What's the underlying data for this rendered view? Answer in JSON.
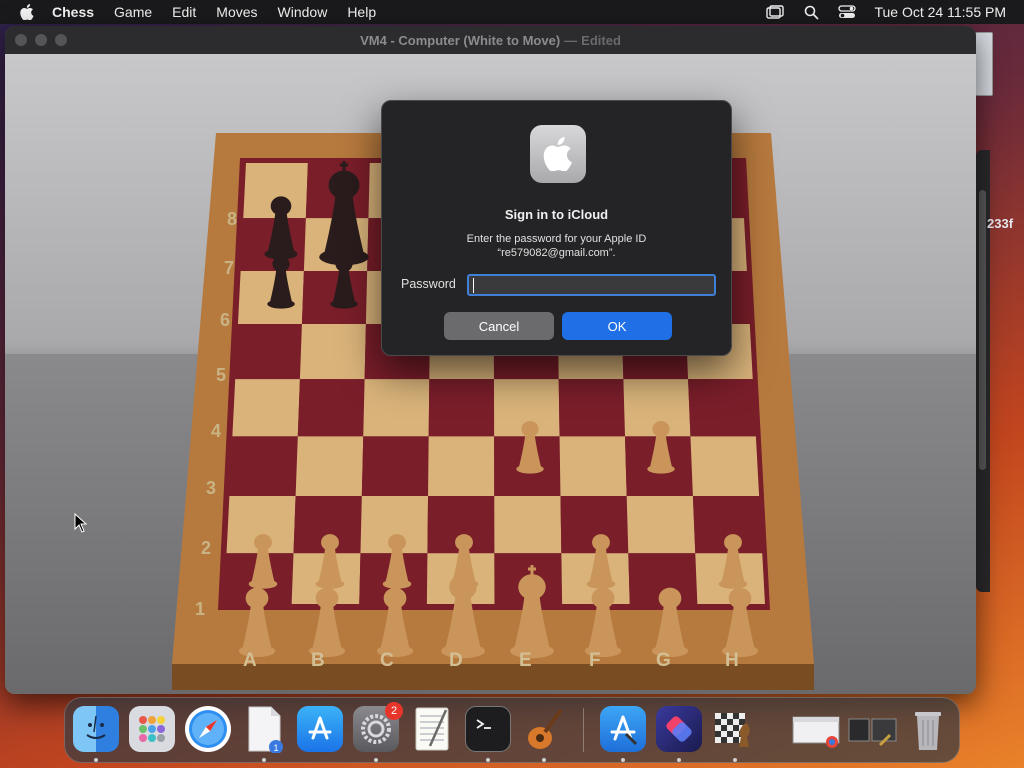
{
  "menubar": {
    "app_name": "Chess",
    "items": [
      "Game",
      "Edit",
      "Moves",
      "Window",
      "Help"
    ],
    "clock": "Tue Oct 24  11:55 PM"
  },
  "window": {
    "title": "VM4 - Computer  (White to Move)",
    "title_sep": "—",
    "title_edited": "Edited"
  },
  "board": {
    "ranks": [
      "8",
      "7",
      "6",
      "5",
      "4",
      "3",
      "2",
      "1"
    ],
    "files": [
      "A",
      "B",
      "C",
      "D",
      "E",
      "F",
      "G",
      "H"
    ],
    "light_square": "#d9b37a",
    "dark_square": "#7a1e2a"
  },
  "dialog": {
    "title": "Sign in to iCloud",
    "message_line1": "Enter the password for your Apple ID",
    "message_line2": "“re579082@gmail.com”.",
    "password_label": "Password",
    "password_value": "",
    "cancel_label": "Cancel",
    "ok_label": "OK"
  },
  "desktop": {
    "partial_text": "233f"
  },
  "dock": {
    "items": [
      {
        "name": "finder",
        "icon": "finder-icon",
        "running": true
      },
      {
        "name": "launchpad",
        "icon": "launchpad-icon",
        "running": false
      },
      {
        "name": "safari",
        "icon": "safari-icon",
        "running": false
      },
      {
        "name": "textedit-doc",
        "icon": "document-icon",
        "running": true
      },
      {
        "name": "app-store",
        "icon": "app-store-icon",
        "running": false
      },
      {
        "name": "system-settings",
        "icon": "gear-icon",
        "badge": "2",
        "running": true
      },
      {
        "name": "textedit",
        "icon": "textedit-icon",
        "running": false
      },
      {
        "name": "terminal",
        "icon": "terminal-icon",
        "running": true
      },
      {
        "name": "garageband",
        "icon": "guitar-icon",
        "running": true
      },
      {
        "name": "xcode-installer",
        "icon": "xcode-icon",
        "running": true
      },
      {
        "name": "shortcuts",
        "icon": "shortcuts-icon",
        "running": true
      },
      {
        "name": "chess",
        "icon": "chess-icon",
        "running": true
      },
      {
        "name": "chrome-window",
        "icon": "window-thumbnail-icon",
        "running": false
      },
      {
        "name": "preview-window",
        "icon": "window-thumbnail-icon",
        "running": false
      },
      {
        "name": "trash",
        "icon": "trash-icon",
        "running": false
      }
    ]
  }
}
